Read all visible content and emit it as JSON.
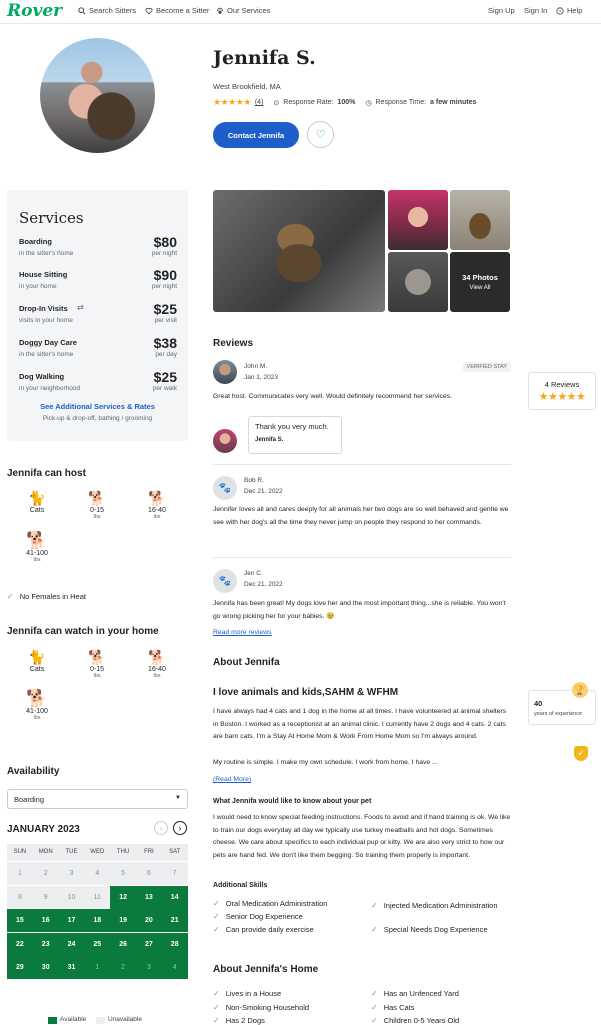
{
  "nav": {
    "logo": "Rover",
    "search": "Search Sitters",
    "become": "Become a Sitter",
    "services": "Our Services",
    "signup": "Sign Up",
    "signin": "Sign In",
    "help": "Help"
  },
  "profile": {
    "name": "Jennifa S.",
    "location": "West Brookfield, MA",
    "review_count": "(4)",
    "response_rate_label": "Response Rate:",
    "response_rate": "100%",
    "response_time_label": "Response Time:",
    "response_time": "a few minutes",
    "contact_label": "Contact Jennifa"
  },
  "services": {
    "title": "Services",
    "items": [
      {
        "name": "Boarding",
        "sub": "in the sitter's home",
        "price": "$80",
        "unit": "per night"
      },
      {
        "name": "House Sitting",
        "sub": "in your home",
        "price": "$90",
        "unit": "per night"
      },
      {
        "name": "Drop-In Visits",
        "sub": "visits in your home",
        "price": "$25",
        "unit": "per visit"
      },
      {
        "name": "Doggy Day Care",
        "sub": "in the sitter's home",
        "price": "$38",
        "unit": "per day"
      },
      {
        "name": "Dog Walking",
        "sub": "in your neighborhood",
        "price": "$25",
        "unit": "per walk"
      }
    ],
    "see_more": "See Additional Services & Rates",
    "additional": "Pick-up & drop-off, bathing / grooming"
  },
  "host": {
    "title": "Jennifa can host",
    "pets": [
      {
        "label": "Cats",
        "sub": ""
      },
      {
        "label": "0-15",
        "sub": "lbs"
      },
      {
        "label": "16-40",
        "sub": "lbs"
      },
      {
        "label": "41-100",
        "sub": "lbs"
      }
    ],
    "note": "No Females in Heat"
  },
  "watch": {
    "title": "Jennifa can watch in your home",
    "pets": [
      {
        "label": "Cats",
        "sub": ""
      },
      {
        "label": "0-15",
        "sub": "lbs"
      },
      {
        "label": "16-40",
        "sub": "lbs"
      },
      {
        "label": "41-100",
        "sub": "lbs"
      }
    ]
  },
  "availability": {
    "title": "Availability",
    "selected": "Boarding",
    "month": "JANUARY 2023",
    "days": [
      "SUN",
      "MON",
      "TUE",
      "WED",
      "THU",
      "FRI",
      "SAT"
    ],
    "weeks": [
      [
        "1",
        "2",
        "3",
        "4",
        "5",
        "6",
        "7"
      ],
      [
        "8",
        "9",
        "10",
        "11",
        "12",
        "13",
        "14"
      ],
      [
        "15",
        "16",
        "17",
        "18",
        "19",
        "20",
        "21"
      ],
      [
        "22",
        "23",
        "24",
        "25",
        "26",
        "27",
        "28"
      ],
      [
        "29",
        "30",
        "31",
        "1",
        "2",
        "3",
        "4"
      ]
    ],
    "legend_available": "Available",
    "legend_unavailable": "Unavailable"
  },
  "photos": {
    "count": "34 Photos",
    "view_all": "View All"
  },
  "reviews": {
    "title": "Reviews",
    "summary_count": "4 Reviews",
    "items": [
      {
        "author": "John M.",
        "date": "Jan 1, 2023",
        "badge": "VERIFIED STAY",
        "text": "Great host. Communicates very well. Would definitely recommend her services.",
        "reply": "Thank you very much.",
        "reply_author": "Jennifa S."
      },
      {
        "author": "Bob R.",
        "date": "Dec 21, 2022",
        "text": "Jennifer loves all and cares deeply for all animals her two dogs are so well behaved and gentle we see with her dog's all the time they never jump on people they respond to her commands."
      },
      {
        "author": "Jen C.",
        "date": "Dec 21, 2022",
        "text": "Jennifa has been great! My dogs love her and the most important thing...she is reliable. You won't go wrong picking her for your babies. 🥹"
      }
    ],
    "read_more": "Read more reviews"
  },
  "about": {
    "title": "About Jennifa",
    "headline": "I love animals and kids,SAHM & WFHM",
    "para1": "I have always had 4 cats and 1 dog in the home at all times. I have volunteered at animal shelters in Boston. I worked as a receptionist at an animal clinic. I currently have 2 dogs and 4 cats. 2 cats are barn cats. I'm a Stay At Home Mom & Work From Home Mom so I'm always around.",
    "para2": "My routine is simple. I make my own schedule. I work from home. I have ...",
    "read_more": "(Read More)",
    "know_title": "What Jennifa would like to know about your pet",
    "know_text": "I would need to know special feeding instructions. Foods to avoid and if hand training is ok. We like to train our dogs everyday all day we typically use turkey meatballs and hot dogs. Sometimes cheese. We care about specifics to each individual pup or kitty. We are also very strict to how our pets are hand fed. We don't like them begging. So training them properly is important.",
    "skills_title": "Additional Skills",
    "skills": [
      "Oral Medication Administration",
      "Injected Medication Administration",
      "Senior Dog Experience",
      "Special Needs Dog Experience",
      "Can provide daily exercise"
    ],
    "experience_years": "40",
    "experience_label": "years of experience"
  },
  "home": {
    "title": "About Jennifa's Home",
    "items": [
      "Lives in a House",
      "Has an Unfenced Yard",
      "Non-Smoking Household",
      "Has Cats",
      "Has 2 Dogs",
      "Children 0-5 Years Old"
    ]
  }
}
